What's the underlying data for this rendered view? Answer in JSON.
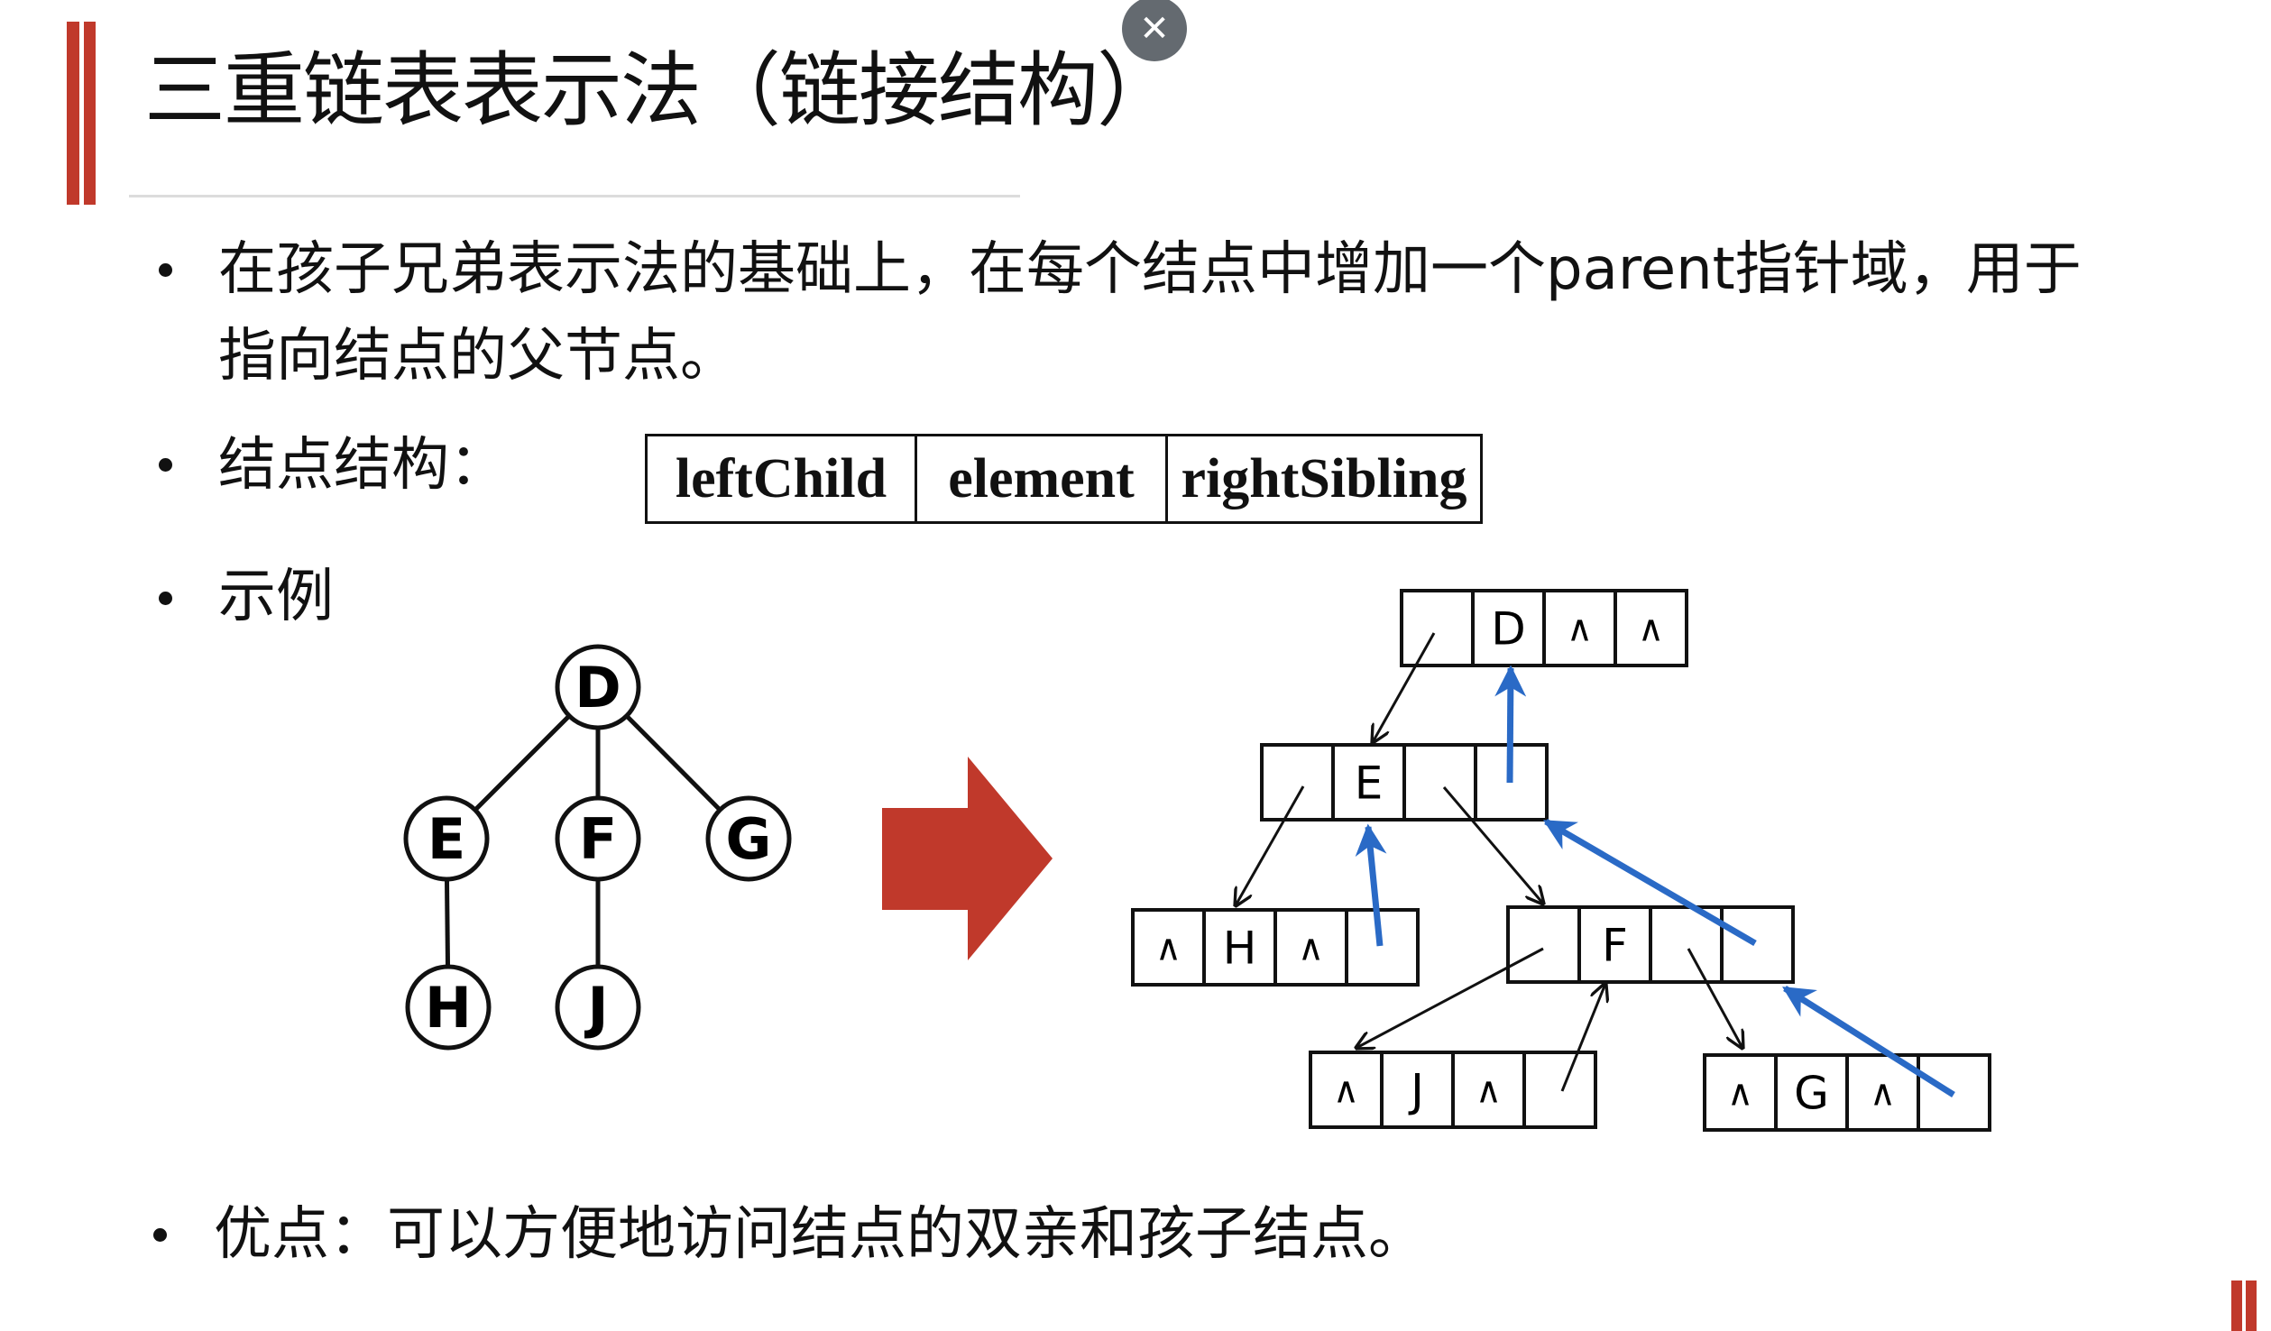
{
  "slide": {
    "title": "三重链表表示法（链接结构）",
    "close_icon": "close-icon",
    "accent_color": "#c0392b",
    "pointer_color": "#2a6ac6",
    "bullets": [
      {
        "line1": "在孩子兄弟表示法的基础上，在每个结点中增加一个parent指针域，用于",
        "line2": "指向结点的父节点。"
      },
      {
        "text": "结点结构："
      },
      {
        "text": "示例"
      },
      {
        "text": "优点：可以方便地访问结点的双亲和孩子结点。"
      }
    ],
    "node_structure": [
      "leftChild",
      "element",
      "rightSibling"
    ]
  },
  "tree": {
    "nodes": [
      "D",
      "E",
      "F",
      "G",
      "H",
      "J"
    ],
    "edges": [
      [
        "D",
        "E"
      ],
      [
        "D",
        "F"
      ],
      [
        "D",
        "G"
      ],
      [
        "E",
        "H"
      ],
      [
        "F",
        "J"
      ]
    ]
  },
  "linked": {
    "nodes": [
      {
        "id": "D",
        "cells": [
          "",
          "D",
          "∧",
          "∧"
        ]
      },
      {
        "id": "E",
        "cells": [
          "",
          "E",
          "",
          ""
        ]
      },
      {
        "id": "H",
        "cells": [
          "∧",
          "H",
          "∧",
          ""
        ]
      },
      {
        "id": "F",
        "cells": [
          "",
          "F",
          "",
          ""
        ]
      },
      {
        "id": "J",
        "cells": [
          "∧",
          "J",
          "∧",
          ""
        ]
      },
      {
        "id": "G",
        "cells": [
          "∧",
          "G",
          "∧",
          ""
        ]
      }
    ],
    "child_links": [
      [
        "D",
        "E"
      ],
      [
        "E",
        "H"
      ],
      [
        "E",
        "F"
      ],
      [
        "F",
        "J"
      ],
      [
        "J",
        "F"
      ],
      [
        "F",
        "G"
      ]
    ],
    "parent_links": [
      [
        "E",
        "D"
      ],
      [
        "H",
        "E"
      ],
      [
        "F",
        "E"
      ],
      [
        "G",
        "F"
      ]
    ]
  }
}
